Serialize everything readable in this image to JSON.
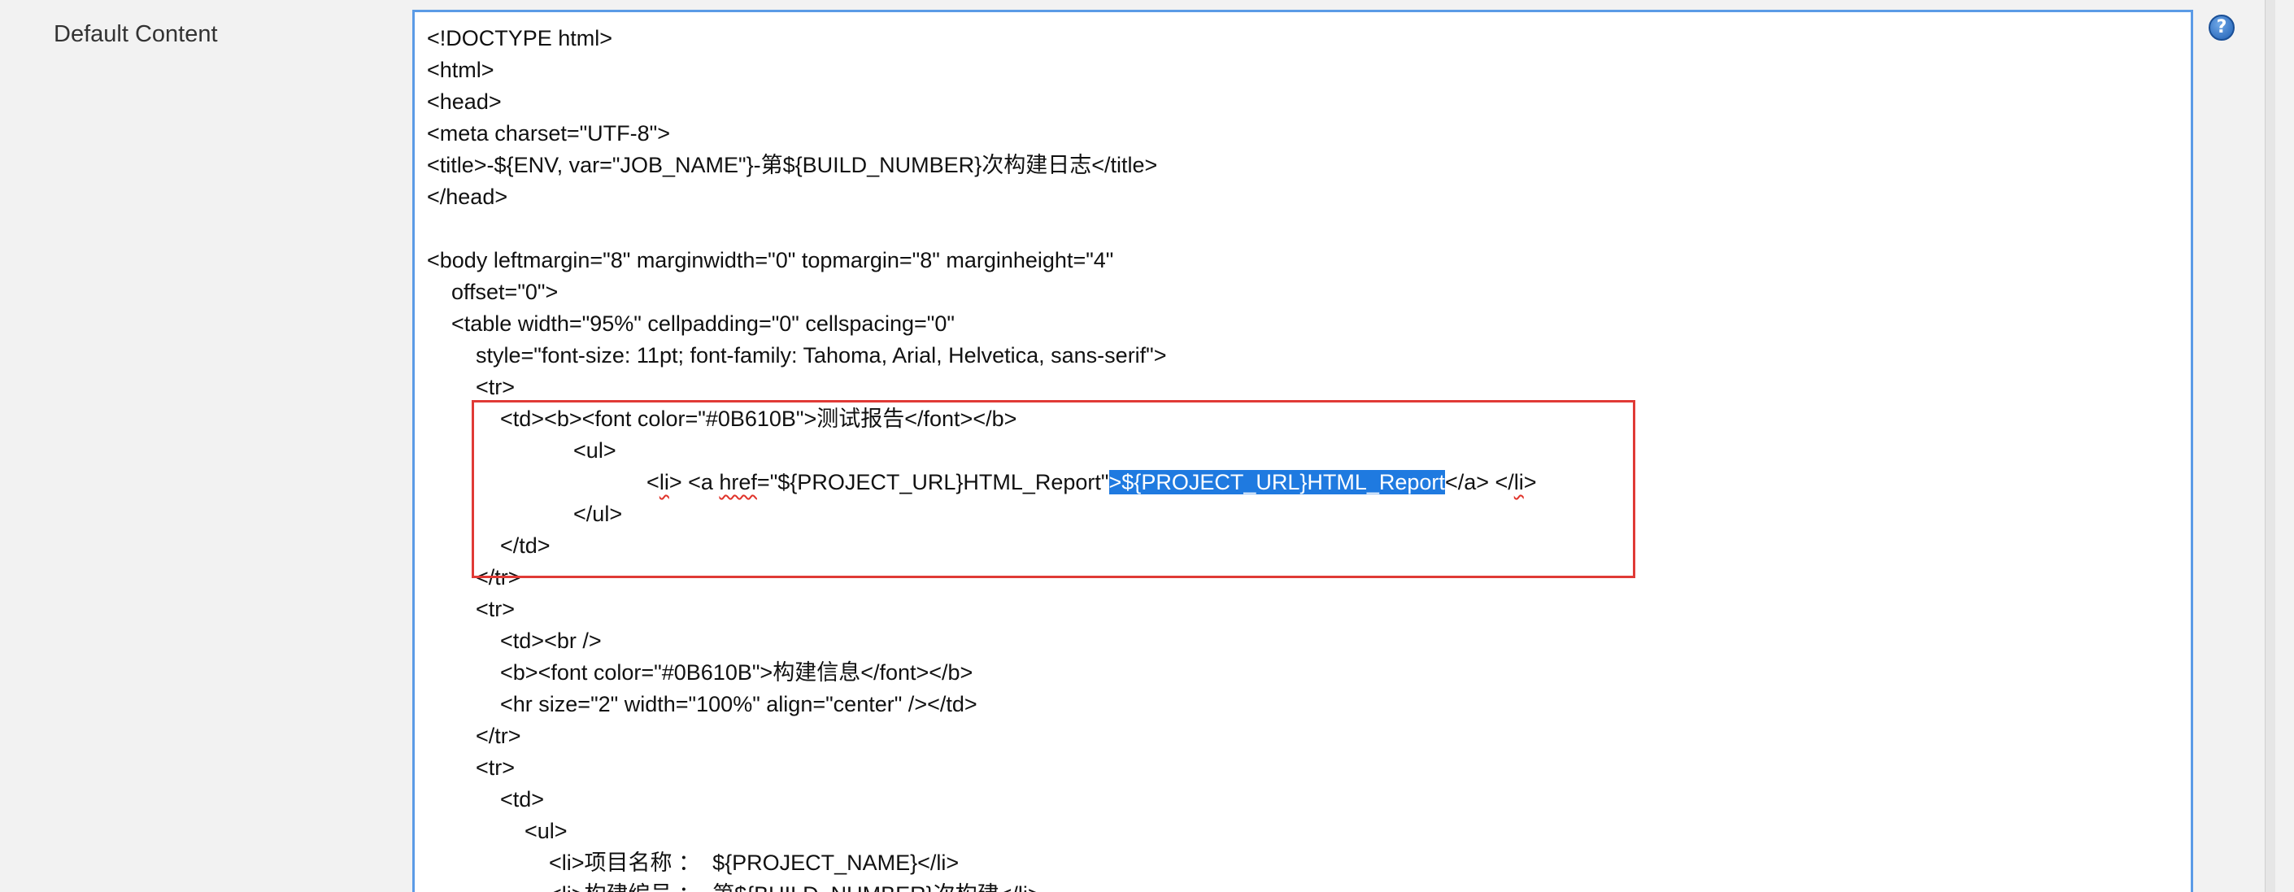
{
  "field": {
    "label": "Default Content"
  },
  "help_icon": {
    "glyph": "?"
  },
  "editor": {
    "lines": [
      "<!DOCTYPE html>",
      "<html>",
      "<head>",
      "<meta charset=\"UTF-8\">",
      "<title>-${ENV, var=\"JOB_NAME\"}-第${BUILD_NUMBER}次构建日志</title>",
      "</head>",
      "",
      "<body leftmargin=\"8\" marginwidth=\"0\" topmargin=\"8\" marginheight=\"4\"",
      "    offset=\"0\">",
      "    <table width=\"95%\" cellpadding=\"0\" cellspacing=\"0\"",
      "        style=\"font-size: 11pt; font-family: Tahoma, Arial, Helvetica, sans-serif\">",
      "        <tr>",
      "            <td><b><font color=\"#0B610B\">测试报告</font></b>",
      "                        <ul>",
      "",
      "                        </ul>",
      "            </td>",
      "        </tr>",
      "        <tr>",
      "            <td><br />",
      "            <b><font color=\"#0B610B\">构建信息</font></b>",
      "            <hr size=\"2\" width=\"100%\" align=\"center\" /></td>",
      "        </tr>",
      "        <tr>",
      "            <td>",
      "                <ul>",
      "                    <li>项目名称 ：  ${PROJECT_NAME}</li>",
      "                    <li>构建编号 ：  第${BUILD_NUMBER}次构建</li>"
    ],
    "li_line": {
      "indent": "                                    <",
      "li_open": "li",
      "mid1": "> <a ",
      "href": "href",
      "mid2": "=\"${PROJECT_URL}HTML_Report\"",
      "selected": ">${PROJECT_URL}HTML_Report",
      "tail1": "</a> </",
      "li_close": "li",
      "tail2": ">"
    }
  },
  "colors": {
    "editor_border": "#5b9be6",
    "highlight_border": "#e03a36",
    "selection": "#1f7ae0"
  }
}
